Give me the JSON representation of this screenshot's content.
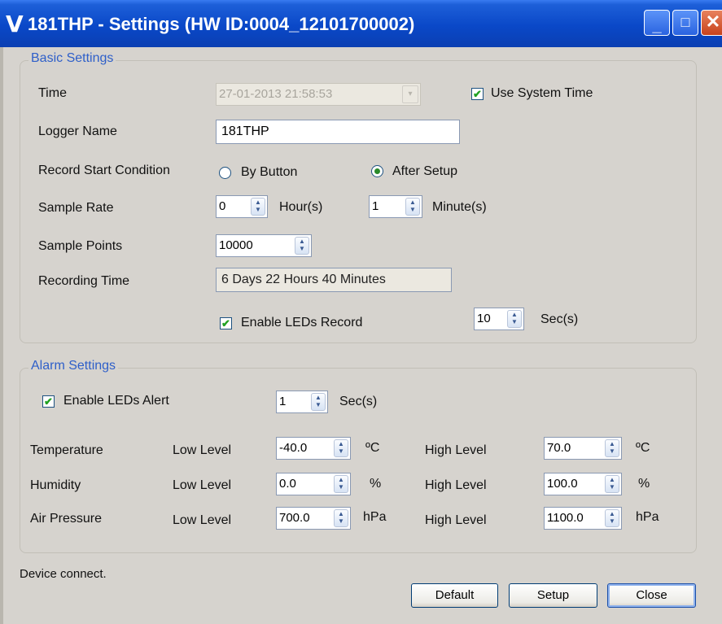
{
  "window": {
    "logo_glyph": "V",
    "title": "181THP - Settings (HW ID:0004_12101700002)",
    "controls": {
      "minimize": "_",
      "maximize": "□",
      "close": "✕"
    }
  },
  "basic": {
    "title": "Basic Settings",
    "time_label": "Time",
    "time_value": "27-01-2013 21:58:53",
    "use_system_time_label": "Use System Time",
    "use_system_time_checked": true,
    "logger_name_label": "Logger Name",
    "logger_name_value": "181THP",
    "record_start_label": "Record Start Condition",
    "by_button_label": "By Button",
    "after_setup_label": "After Setup",
    "record_start_selected": "After Setup",
    "sample_rate_label": "Sample Rate",
    "hours_value": "0",
    "hours_unit": "Hour(s)",
    "minutes_value": "1",
    "minutes_unit": "Minute(s)",
    "sample_points_label": "Sample Points",
    "sample_points_value": "10000",
    "recording_time_label": "Recording Time",
    "recording_time_value": "6 Days 22 Hours 40 Minutes",
    "enable_leds_record_label": "Enable LEDs Record",
    "enable_leds_record_checked": true,
    "leds_record_value": "10",
    "leds_record_unit": "Sec(s)"
  },
  "alarm": {
    "title": "Alarm Settings",
    "enable_leds_alert_label": "Enable LEDs Alert",
    "enable_leds_alert_checked": true,
    "leds_alert_value": "1",
    "leds_alert_unit": "Sec(s)",
    "low_label": "Low Level",
    "high_label": "High Level",
    "rows": [
      {
        "name": "Temperature",
        "low": "-40.0",
        "high": "70.0",
        "unit": "ºC"
      },
      {
        "name": "Humidity",
        "low": "0.0",
        "high": "100.0",
        "unit": "%"
      },
      {
        "name": "Air Pressure",
        "low": "700.0",
        "high": "1100.0",
        "unit": "hPa"
      }
    ]
  },
  "status_text": "Device connect.",
  "buttons": {
    "default": "Default",
    "setup": "Setup",
    "close": "Close"
  },
  "icons": {
    "check": "✔",
    "dropdown": "▾",
    "spin_up": "▲",
    "spin_down": "▼"
  }
}
